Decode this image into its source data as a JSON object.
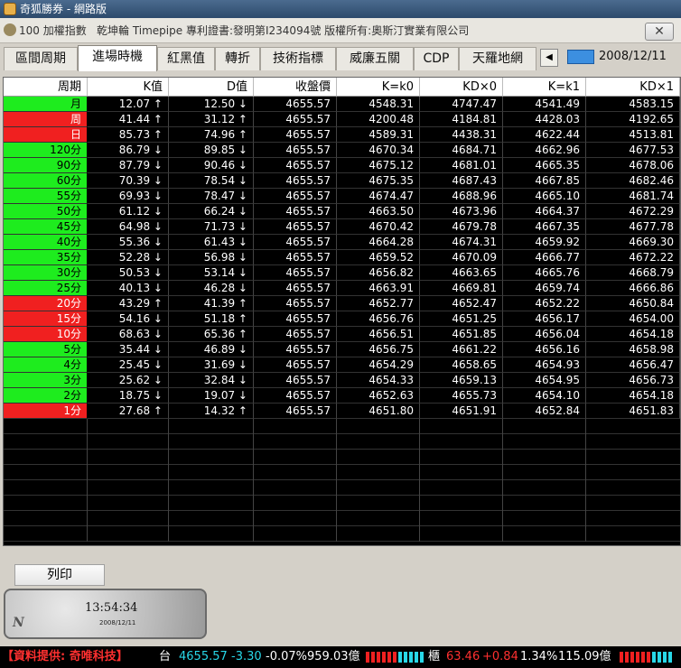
{
  "window": {
    "title": "奇狐勝券 - 網路版",
    "close_label": "✕"
  },
  "infobar": {
    "index": "100 加權指數",
    "copyright": "乾坤輪 Timepipe 專利證書:發明第I234094號 版權所有:奧斯汀實業有限公司"
  },
  "tabs": [
    "區間周期",
    "進場時機",
    "紅黑值",
    "轉折",
    "技術指標",
    "威廉五關",
    "CDP",
    "天羅地網"
  ],
  "active_tab": 1,
  "tab_scroll_left": "◀",
  "date": "2008/12/11",
  "table": {
    "headers": [
      "周期",
      "K值",
      "D值",
      "收盤價",
      "K=k0",
      "KD×0",
      "K=k1",
      "KD×1"
    ],
    "rows": [
      {
        "period": "月",
        "color": "green",
        "k": "12.07 ↑",
        "d": "12.50 ↓",
        "close": "4655.57",
        "k0": "4548.31",
        "kd0": "4747.47",
        "k1": "4541.49",
        "kd1": "4583.15"
      },
      {
        "period": "周",
        "color": "red",
        "k": "41.44 ↑",
        "d": "31.12 ↑",
        "close": "4655.57",
        "k0": "4200.48",
        "kd0": "4184.81",
        "k1": "4428.03",
        "kd1": "4192.65"
      },
      {
        "period": "日",
        "color": "red",
        "k": "85.73 ↑",
        "d": "74.96 ↑",
        "close": "4655.57",
        "k0": "4589.31",
        "kd0": "4438.31",
        "k1": "4622.44",
        "kd1": "4513.81"
      },
      {
        "period": "120分",
        "color": "green",
        "k": "86.79 ↓",
        "d": "89.85 ↓",
        "close": "4655.57",
        "k0": "4670.34",
        "kd0": "4684.71",
        "k1": "4662.96",
        "kd1": "4677.53"
      },
      {
        "period": "90分",
        "color": "green",
        "k": "87.79 ↓",
        "d": "90.46 ↓",
        "close": "4655.57",
        "k0": "4675.12",
        "kd0": "4681.01",
        "k1": "4665.35",
        "kd1": "4678.06"
      },
      {
        "period": "60分",
        "color": "green",
        "k": "70.39 ↓",
        "d": "78.54 ↓",
        "close": "4655.57",
        "k0": "4675.35",
        "kd0": "4687.43",
        "k1": "4667.85",
        "kd1": "4682.46"
      },
      {
        "period": "55分",
        "color": "green",
        "k": "69.93 ↓",
        "d": "78.47 ↓",
        "close": "4655.57",
        "k0": "4674.47",
        "kd0": "4688.96",
        "k1": "4665.10",
        "kd1": "4681.74"
      },
      {
        "period": "50分",
        "color": "green",
        "k": "61.12 ↓",
        "d": "66.24 ↓",
        "close": "4655.57",
        "k0": "4663.50",
        "kd0": "4673.96",
        "k1": "4664.37",
        "kd1": "4672.29"
      },
      {
        "period": "45分",
        "color": "green",
        "k": "64.98 ↓",
        "d": "71.73 ↓",
        "close": "4655.57",
        "k0": "4670.42",
        "kd0": "4679.78",
        "k1": "4667.35",
        "kd1": "4677.78"
      },
      {
        "period": "40分",
        "color": "green",
        "k": "55.36 ↓",
        "d": "61.43 ↓",
        "close": "4655.57",
        "k0": "4664.28",
        "kd0": "4674.31",
        "k1": "4659.92",
        "kd1": "4669.30"
      },
      {
        "period": "35分",
        "color": "green",
        "k": "52.28 ↓",
        "d": "56.98 ↓",
        "close": "4655.57",
        "k0": "4659.52",
        "kd0": "4670.09",
        "k1": "4666.77",
        "kd1": "4672.22"
      },
      {
        "period": "30分",
        "color": "green",
        "k": "50.53 ↓",
        "d": "53.14 ↓",
        "close": "4655.57",
        "k0": "4656.82",
        "kd0": "4663.65",
        "k1": "4665.76",
        "kd1": "4668.79"
      },
      {
        "period": "25分",
        "color": "green",
        "k": "40.13 ↓",
        "d": "46.28 ↓",
        "close": "4655.57",
        "k0": "4663.91",
        "kd0": "4669.81",
        "k1": "4659.74",
        "kd1": "4666.86"
      },
      {
        "period": "20分",
        "color": "red",
        "k": "43.29 ↑",
        "d": "41.39 ↑",
        "close": "4655.57",
        "k0": "4652.77",
        "kd0": "4652.47",
        "k1": "4652.22",
        "kd1": "4650.84"
      },
      {
        "period": "15分",
        "color": "red",
        "k": "54.16 ↓",
        "d": "51.18 ↑",
        "close": "4655.57",
        "k0": "4656.76",
        "kd0": "4651.25",
        "k1": "4656.17",
        "kd1": "4654.00"
      },
      {
        "period": "10分",
        "color": "red",
        "k": "68.63 ↓",
        "d": "65.36 ↑",
        "close": "4655.57",
        "k0": "4656.51",
        "kd0": "4651.85",
        "k1": "4656.04",
        "kd1": "4654.18"
      },
      {
        "period": "5分",
        "color": "green",
        "k": "35.44 ↓",
        "d": "46.89 ↓",
        "close": "4655.57",
        "k0": "4656.75",
        "kd0": "4661.22",
        "k1": "4656.16",
        "kd1": "4658.98"
      },
      {
        "period": "4分",
        "color": "green",
        "k": "25.45 ↓",
        "d": "31.69 ↓",
        "close": "4655.57",
        "k0": "4654.29",
        "kd0": "4658.65",
        "k1": "4654.93",
        "kd1": "4656.47"
      },
      {
        "period": "3分",
        "color": "green",
        "k": "25.62 ↓",
        "d": "32.84 ↓",
        "close": "4655.57",
        "k0": "4654.33",
        "kd0": "4659.13",
        "k1": "4654.95",
        "kd1": "4656.73"
      },
      {
        "period": "2分",
        "color": "green",
        "k": "18.75 ↓",
        "d": "19.07 ↓",
        "close": "4655.57",
        "k0": "4652.63",
        "kd0": "4655.73",
        "k1": "4654.10",
        "kd1": "4654.18"
      },
      {
        "period": "1分",
        "color": "red",
        "k": "27.68 ↑",
        "d": "14.32 ↑",
        "close": "4655.57",
        "k0": "4651.80",
        "kd0": "4651.91",
        "k1": "4652.84",
        "kd1": "4651.83"
      }
    ]
  },
  "print_button": "列印",
  "clock": {
    "time": "13:54:34",
    "date": "2008/12/11",
    "mark": "N"
  },
  "status": {
    "provider": "【資料提供: 奇唯科技】",
    "tai_label": "台",
    "tai_price": "4655.57",
    "tai_change": "-3.30",
    "tai_pct": "-0.07%",
    "tai_volume": "959.03億",
    "otc_label": "櫃",
    "otc_price": "63.46",
    "otc_change": "+0.84",
    "otc_pct": "1.34%",
    "otc_volume": "115.09億"
  },
  "colors": {
    "green": "#1eec1e",
    "red": "#f02020",
    "cyan": "#28d8e8",
    "provider": "#ff3030"
  }
}
